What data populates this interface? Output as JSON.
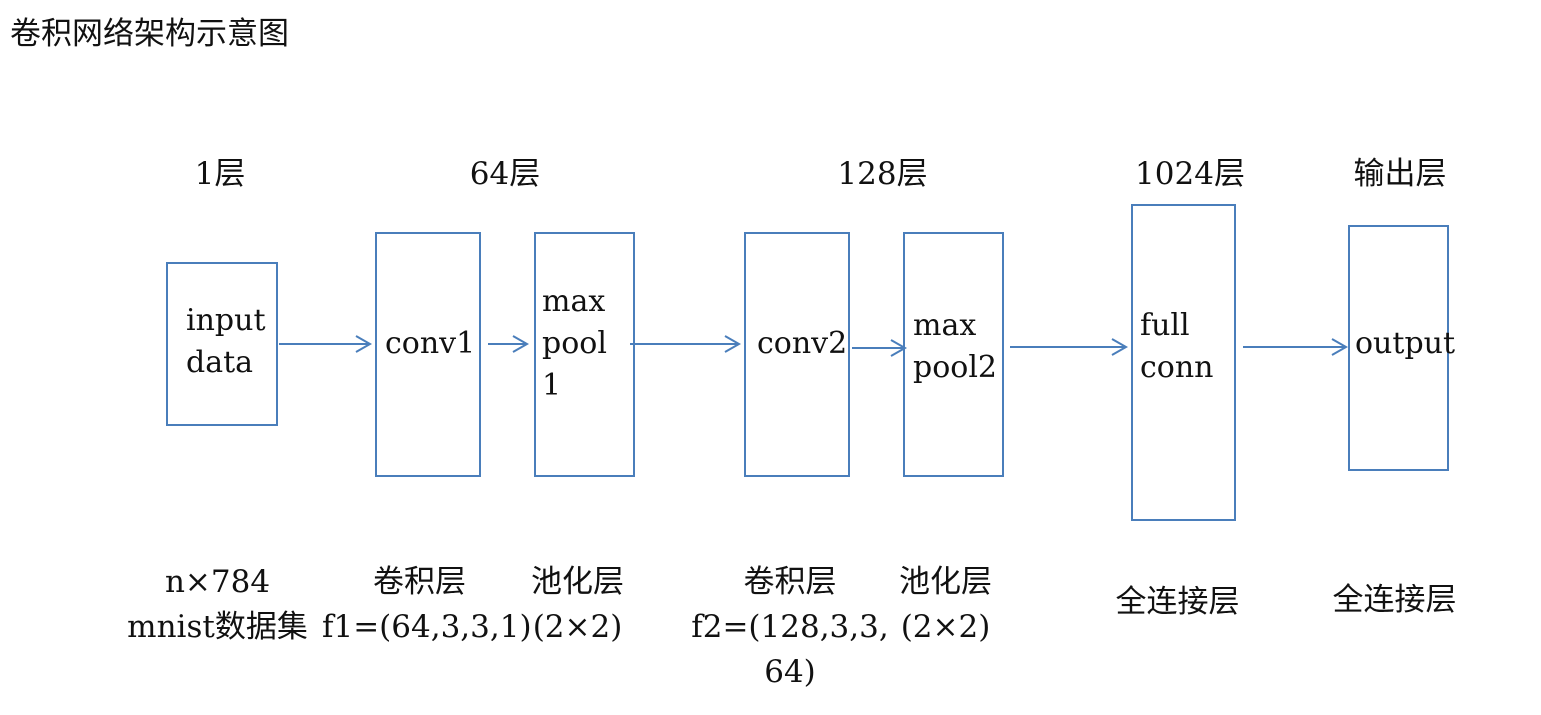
{
  "title": "卷积网络架构示意图",
  "layer_labels": [
    "1层",
    "64层",
    "128层",
    "1024层",
    "输出层"
  ],
  "boxes": {
    "input": [
      "input",
      "data"
    ],
    "conv1": [
      "conv1"
    ],
    "pool1": [
      "max",
      "pool",
      "1"
    ],
    "conv2": [
      "conv2"
    ],
    "pool2": [
      "max",
      "pool2"
    ],
    "fc": [
      "full",
      "conn"
    ],
    "output": [
      "output"
    ]
  },
  "captions": {
    "input": [
      "n×784",
      "mnist数据集"
    ],
    "conv1": [
      "卷积层",
      "f1=(64,3,3,1)"
    ],
    "pool1": [
      "池化层",
      "(2×2)"
    ],
    "conv2": [
      "卷积层",
      "f2=(128,3,3,",
      "64)"
    ],
    "pool2": [
      "池化层",
      "(2×2)"
    ],
    "fc": [
      "全连接层"
    ],
    "output": [
      "全连接层"
    ]
  },
  "colors": {
    "box_border": "#4a7ebb",
    "arrow": "#4a7ebb"
  }
}
